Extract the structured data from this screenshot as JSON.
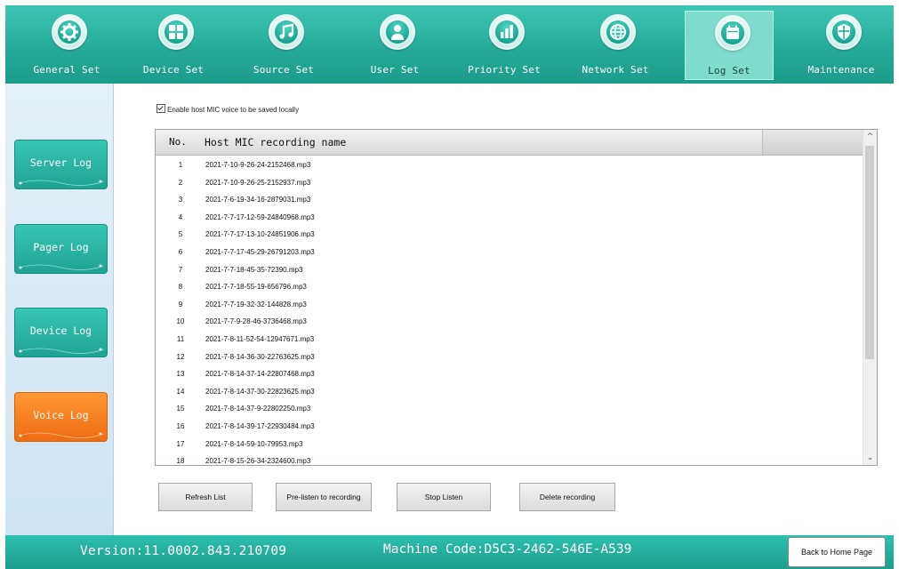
{
  "toolbar": {
    "tabs": [
      {
        "label": "General Set",
        "icon": "gear-icon"
      },
      {
        "label": "Device Set",
        "icon": "grid-icon"
      },
      {
        "label": "Source Set",
        "icon": "music-note-icon"
      },
      {
        "label": "User Set",
        "icon": "user-icon"
      },
      {
        "label": "Priority Set",
        "icon": "bar-chart-icon"
      },
      {
        "label": "Network Set",
        "icon": "globe-icon"
      },
      {
        "label": "Log Set",
        "icon": "calendar-icon"
      },
      {
        "label": "Maintenance",
        "icon": "shield-icon"
      }
    ],
    "active": "Log Set"
  },
  "sidebar": {
    "items": [
      {
        "label": "Server Log"
      },
      {
        "label": "Pager Log"
      },
      {
        "label": "Device Log"
      },
      {
        "label": "Voice Log"
      }
    ],
    "active": "Voice Log"
  },
  "main": {
    "enable_label": "Enable host MIC voice to be saved locally",
    "enable_checked": true,
    "list": {
      "col_no": "No.",
      "col_name": "Host MIC recording name",
      "rows": [
        {
          "no": "1",
          "name": "2021-7-10-9-26-24-2152468.mp3"
        },
        {
          "no": "2",
          "name": "2021-7-10-9-26-25-2152937.mp3"
        },
        {
          "no": "3",
          "name": "2021-7-6-19-34-16-2879031.mp3"
        },
        {
          "no": "4",
          "name": "2021-7-7-17-12-59-24840968.mp3"
        },
        {
          "no": "5",
          "name": "2021-7-7-17-13-10-24851906.mp3"
        },
        {
          "no": "6",
          "name": "2021-7-7-17-45-29-26791203.mp3"
        },
        {
          "no": "7",
          "name": "2021-7-7-18-45-35-72390.mp3"
        },
        {
          "no": "8",
          "name": "2021-7-7-18-55-19-656796.mp3"
        },
        {
          "no": "9",
          "name": "2021-7-7-19-32-32-144828.mp3"
        },
        {
          "no": "10",
          "name": "2021-7-7-9-28-46-3736468.mp3"
        },
        {
          "no": "11",
          "name": "2021-7-8-11-52-54-12947671.mp3"
        },
        {
          "no": "12",
          "name": "2021-7-8-14-36-30-22763625.mp3"
        },
        {
          "no": "13",
          "name": "2021-7-8-14-37-14-22807468.mp3"
        },
        {
          "no": "14",
          "name": "2021-7-8-14-37-30-22823625.mp3"
        },
        {
          "no": "15",
          "name": "2021-7-8-14-37-9-22802250.mp3"
        },
        {
          "no": "16",
          "name": "2021-7-8-14-39-17-22930484.mp3"
        },
        {
          "no": "17",
          "name": "2021-7-8-14-59-10-79953.mp3"
        },
        {
          "no": "18",
          "name": "2021-7-8-15-26-34-2324600.mp3"
        }
      ]
    },
    "buttons": {
      "refresh": "Refresh List",
      "prelisten": "Pre-listen to recording",
      "stop": "Stop Listen",
      "delete": "Delete recording"
    }
  },
  "footer": {
    "version": "Version:11.0002.843.210709",
    "machine_code": "Machine Code:D5C3-2462-546E-A539",
    "home_button": "Back to Home Page"
  },
  "colors": {
    "teal": "#24ab98",
    "active_side": "#f06c12",
    "panel": "#d9eaf5"
  }
}
